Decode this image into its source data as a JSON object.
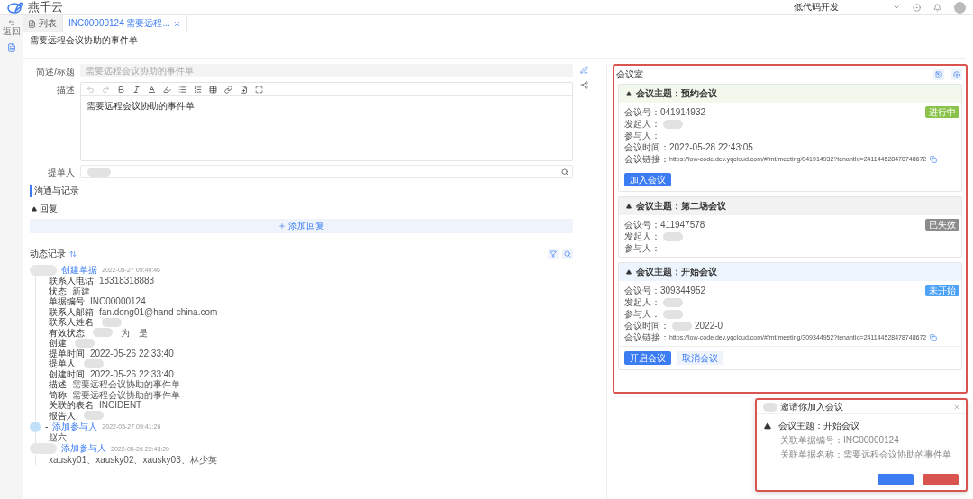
{
  "app": {
    "logo_text": "燕千云",
    "workspace": "低代码开发"
  },
  "rail": {
    "back_label": "返回"
  },
  "tabs": [
    {
      "label": "列表",
      "selected": false,
      "kind": "list"
    },
    {
      "label": "INC00000124 需要远程...",
      "selected": true,
      "kind": "record"
    }
  ],
  "page_title": "需要远程会议协助的事件单",
  "form": {
    "fields": [
      {
        "label": "简述/标题",
        "kind": "input",
        "value": "需要远程会议协助的事件单"
      },
      {
        "label": "描述",
        "kind": "editor",
        "value": "需要远程会议协助的事件单"
      },
      {
        "label": "提单人",
        "kind": "search",
        "redacted": true
      }
    ]
  },
  "communication": {
    "title": "沟通与记录",
    "reply_label": "回复",
    "reply_expanded": true,
    "add_reply": "添加回复"
  },
  "activity": {
    "title": "动态记录",
    "entries": [
      {
        "kind": "person",
        "action": "创建单据",
        "time": "2022-05-27 09:40:46",
        "fields": [
          {
            "label": "联系人电话",
            "value": "18318318883"
          },
          {
            "label": "状态",
            "value": "新建"
          },
          {
            "label": "单据编号",
            "value": "INC00000124"
          },
          {
            "label": "联系人邮箱",
            "value": "fan.dong01@hand-china.com"
          },
          {
            "label": "联系人姓名",
            "redacted": true
          },
          {
            "label": "有效状态",
            "value": "为　是",
            "redacted": true
          },
          {
            "label": "创建",
            "redacted": true
          },
          {
            "label": "提单时间",
            "value": "2022-05-26 22:33:40"
          },
          {
            "label": "提单人",
            "redacted": true
          },
          {
            "label": "创建时间",
            "value": "2022-05-26 22:33:40"
          },
          {
            "label": "描述",
            "value": "需要远程会议协助的事件单"
          },
          {
            "label": "简称",
            "value": "需要远程会议协助的事件单"
          },
          {
            "label": "关联的表名",
            "value": "INCIDENT"
          },
          {
            "label": "报告人",
            "redacted": true
          }
        ]
      },
      {
        "kind": "system",
        "prefix": "-",
        "action": "添加参与人",
        "time": "2022-05-27 09:41:26",
        "body": "赵六"
      },
      {
        "kind": "person",
        "action": "添加参与人",
        "time": "2022-05-26 22:43:20",
        "body": "xausky01、xausky02、xausky03、林少英"
      }
    ]
  },
  "meeting_room": {
    "title": "会议室",
    "meetings": [
      {
        "topic": "会议主题：预约会议",
        "status": "进行中",
        "color": "#8bc34a",
        "rows": [
          {
            "label": "会议号：",
            "value": "041914932"
          },
          {
            "label": "发起人：",
            "redacted": true
          },
          {
            "label": "参与人："
          },
          {
            "label": "会议时间：",
            "value": "2022-05-28 22:43:05"
          }
        ],
        "link_label": "会议链接：",
        "link": "https://low-code.dev.yqcloud.com/#/mt/meeting/041914932?tenantId=241144528478748672",
        "buttons": [
          {
            "label": "加入会议",
            "kind": "primary"
          }
        ]
      },
      {
        "topic": "会议主题：第二场会议",
        "status": "已失效",
        "color": "#8c8c8c",
        "rows": [
          {
            "label": "会议号：",
            "value": "411947578"
          },
          {
            "label": "发起人：",
            "redacted": true
          },
          {
            "label": "参与人："
          }
        ]
      },
      {
        "topic": "会议主题：开始会议",
        "status": "未开始",
        "color": "#4fa3f7",
        "rows": [
          {
            "label": "会议号：",
            "value": "309344952"
          },
          {
            "label": "发起人：",
            "redacted": true
          },
          {
            "label": "参与人：",
            "redacted": true
          },
          {
            "label": "会议时间：",
            "value": "2022-0",
            "redacted": true
          }
        ],
        "link_label": "会议链接：",
        "link": "https://low-code.dev.yqcloud.com/#/mt/meeting/309344952?tenantId=241144528478748672",
        "buttons": [
          {
            "label": "开启会议",
            "kind": "primary"
          },
          {
            "label": "取消会议",
            "kind": "secondary"
          }
        ]
      }
    ]
  },
  "invitation": {
    "title": "邀请你加入会议",
    "topic": "会议主题：开始会议",
    "rows": [
      {
        "label": "关联单据编号：",
        "value": "INC00000124"
      },
      {
        "label": "关联单据名称：",
        "value": "需要远程会议协助的事件单"
      }
    ]
  }
}
